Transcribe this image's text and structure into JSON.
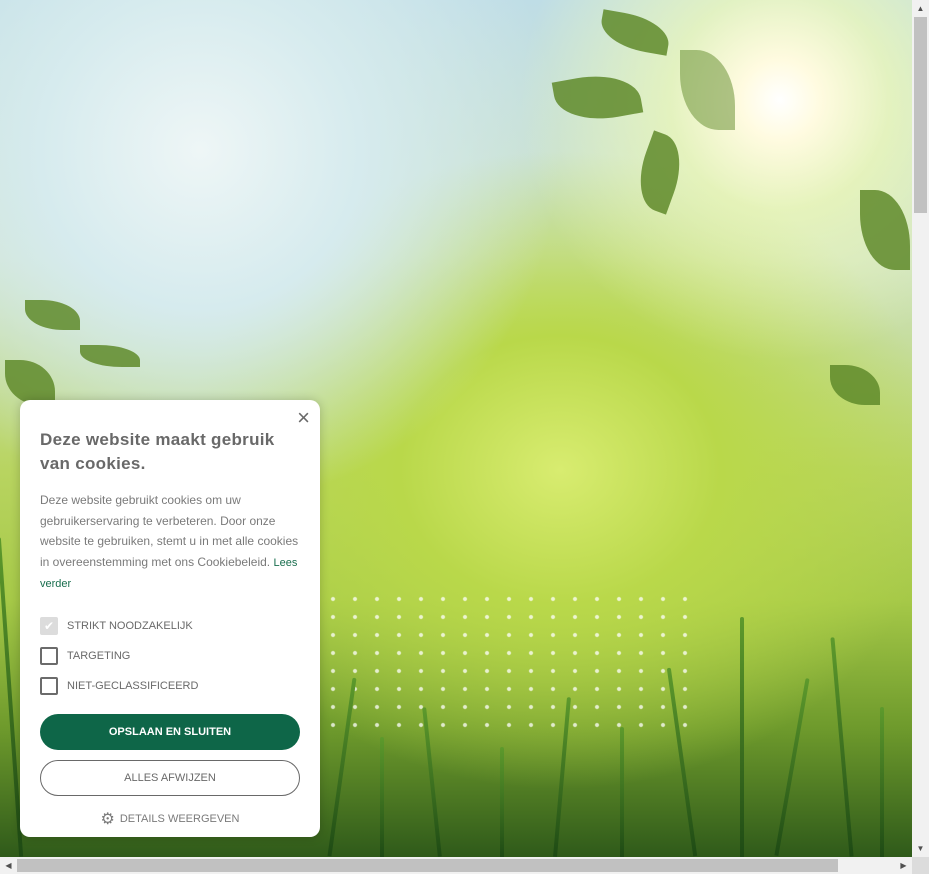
{
  "cookie_dialog": {
    "title": "Deze website maakt gebruik van cookies.",
    "description": "Deze website gebruikt cookies om uw gebruikerservaring te verbeteren. Door onze website te gebruiken, stemt u in met alle cookies in overeenstemming met ons Cookiebeleid.",
    "read_more": "Lees verder",
    "options": [
      {
        "label": "STRIKT NOODZAKELIJK",
        "checked": true,
        "disabled": true
      },
      {
        "label": "TARGETING",
        "checked": false
      },
      {
        "label": "NIET-GECLASSIFICEERD",
        "checked": false
      }
    ],
    "save_label": "OPSLAAN EN SLUITEN",
    "reject_label": "ALLES AFWIJZEN",
    "details_label": "DETAILS WEERGEVEN",
    "close_icon": "×",
    "accent_color": "#0e6648"
  }
}
